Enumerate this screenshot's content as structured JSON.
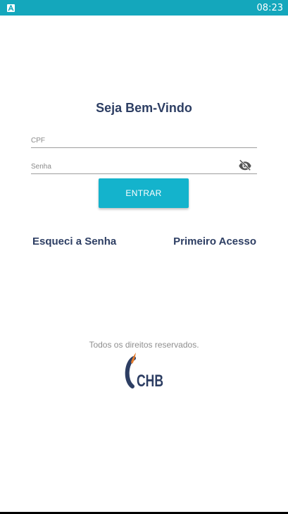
{
  "status_bar": {
    "time": "08:23",
    "app_icon": "android-a-icon",
    "color": "#14a7bc"
  },
  "login": {
    "title": "Seja Bem-Vindo",
    "cpf_placeholder": "CPF",
    "cpf_value": "",
    "senha_placeholder": "Senha",
    "senha_value": "",
    "visibility_icon": "eye-off-icon",
    "submit_label": "ENTRAR",
    "accent_color": "#14b3cc"
  },
  "links": {
    "forgot_password": "Esqueci a Senha",
    "first_access": "Primeiro Acesso"
  },
  "footer": {
    "rights": "Todos os direitos reservados.",
    "logo_text": "CHB"
  }
}
